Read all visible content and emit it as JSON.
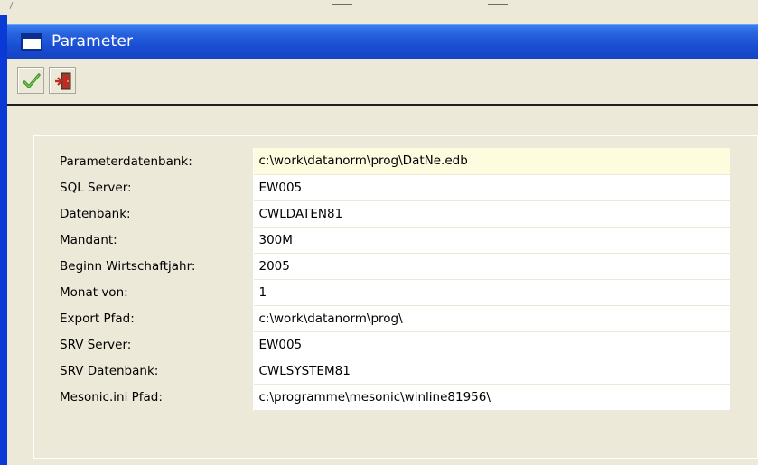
{
  "window": {
    "title": "Parameter",
    "icon": "window-icon"
  },
  "toolbar": {
    "buttons": [
      {
        "name": "confirm-button",
        "icon": "check-icon",
        "color": "#2f8b1d"
      },
      {
        "name": "exit-button",
        "icon": "exit-door-icon",
        "color": "#c0282a"
      }
    ]
  },
  "parameters": {
    "rows": [
      {
        "label": "Parameterdatenbank:",
        "value": "c:\\work\\datanorm\\prog\\DatNe.edb",
        "selected": true
      },
      {
        "label": "SQL Server:",
        "value": "EW005"
      },
      {
        "label": "Datenbank:",
        "value": "CWLDATEN81"
      },
      {
        "label": "Mandant:",
        "value": "300M"
      },
      {
        "label": "Beginn Wirtschaftjahr:",
        "value": "2005"
      },
      {
        "label": "Monat von:",
        "value": "1"
      },
      {
        "label": "Export Pfad:",
        "value": "c:\\work\\datanorm\\prog\\"
      },
      {
        "label": "SRV Server:",
        "value": "EW005"
      },
      {
        "label": "SRV Datenbank:",
        "value": "CWLSYSTEM81"
      },
      {
        "label": "Mesonic.ini Pfad:",
        "value": "c:\\programme\\mesonic\\winline81956\\"
      }
    ]
  },
  "colors": {
    "title_bar": "#1a4fd4",
    "window_bg": "#ece9d8",
    "selected_row": "#fefcde"
  }
}
